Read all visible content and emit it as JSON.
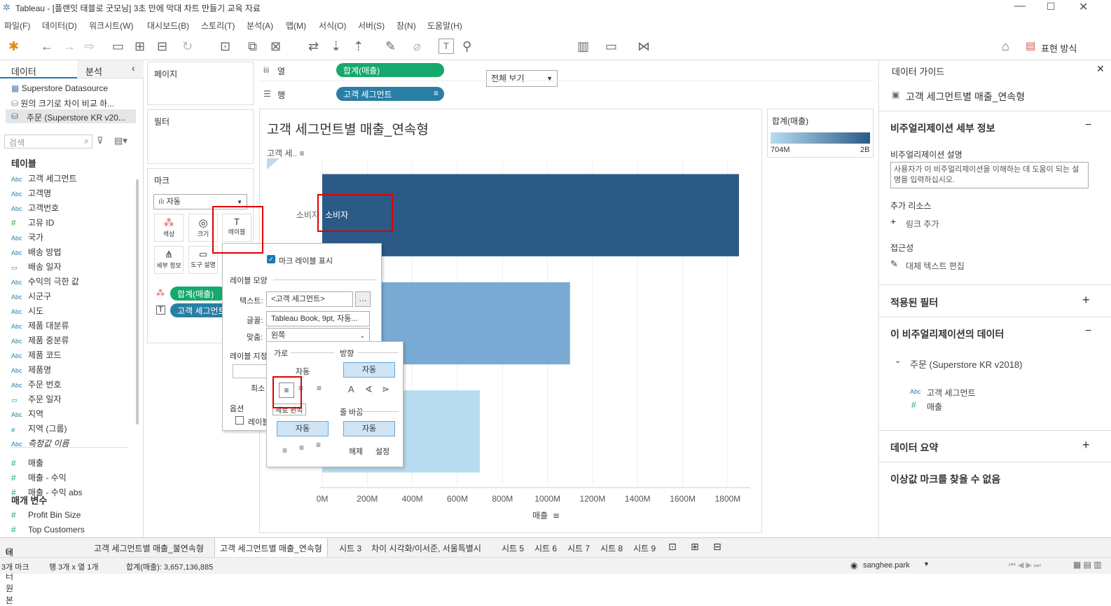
{
  "window": {
    "title": "Tableau - [플랜잇 태블로 굿모닝] 3초 만에 막대 차트 만들기 교육 자료"
  },
  "menu": [
    "파일(F)",
    "데이터(D)",
    "워크시트(W)",
    "대시보드(B)",
    "스토리(T)",
    "분석(A)",
    "맵(M)",
    "서식(O)",
    "서버(S)",
    "창(N)",
    "도움말(H)"
  ],
  "toolbar": {
    "view_select": "전체 보기",
    "show_me": "표현 방식"
  },
  "left": {
    "tab_data": "데이터",
    "tab_analysis": "분석",
    "sources": [
      "Superstore Datasource",
      "원의 크기로 차이 비교 하...",
      "주문 (Superstore KR v20..."
    ],
    "search_placeholder": "검색",
    "tables_header": "테이블",
    "fields": [
      {
        "t": "Abc",
        "n": "고객 세그먼트"
      },
      {
        "t": "Abc",
        "n": "고객명"
      },
      {
        "t": "Abc",
        "n": "고객번호"
      },
      {
        "t": "#",
        "n": "고유 ID"
      },
      {
        "t": "Abc",
        "n": "국가"
      },
      {
        "t": "Abc",
        "n": "배송 방법"
      },
      {
        "t": "date",
        "n": "배송 일자"
      },
      {
        "t": "Abc",
        "n": "수익의 극한 값"
      },
      {
        "t": "Abc",
        "n": "시군구"
      },
      {
        "t": "Abc",
        "n": "시도"
      },
      {
        "t": "Abc",
        "n": "제품 대분류"
      },
      {
        "t": "Abc",
        "n": "제품 중분류"
      },
      {
        "t": "Abc",
        "n": "제품 코드"
      },
      {
        "t": "Abc",
        "n": "제품명"
      },
      {
        "t": "Abc",
        "n": "주문 번호"
      },
      {
        "t": "date",
        "n": "주문 일자"
      },
      {
        "t": "Abc",
        "n": "지역"
      },
      {
        "t": "clip",
        "n": "지역 (그룹)"
      },
      {
        "t": "Abc",
        "n": "측정값 이름"
      },
      {
        "t": "#",
        "n": "매출"
      },
      {
        "t": "#",
        "n": "매출 - 수익"
      },
      {
        "t": "#",
        "n": "매출 - 수익 abs"
      }
    ],
    "params_header": "매개 변수",
    "params": [
      "Profit Bin Size",
      "Top Customers"
    ]
  },
  "shelves": {
    "pages": "페이지",
    "filters": "필터",
    "marks": "마크",
    "marks_type": "자동",
    "btn_color": "색상",
    "btn_size": "크기",
    "btn_label": "레이블",
    "btn_detail": "세부 정보",
    "btn_tooltip": "도구 설명",
    "mark_pill1": "합계(매출)",
    "mark_pill2": "고객 세그먼트",
    "cols_label": "열",
    "rows_label": "행",
    "cols_pill": "합계(매출)",
    "rows_pill": "고객 세그먼트"
  },
  "chart_data": {
    "type": "bar",
    "title": "고객 세그먼트별 매출_연속형",
    "categories": [
      "소비자",
      "",
      ""
    ],
    "values": [
      1850,
      1100,
      700
    ],
    "xlabel": "매출",
    "ylabel": "고객 세..",
    "xticks": [
      "0M",
      "200M",
      "400M",
      "600M",
      "800M",
      "1000M",
      "1200M",
      "1400M",
      "1600M",
      "1800M"
    ],
    "xlim": [
      0,
      1900
    ],
    "colors": [
      "#2b5a87",
      "#79aad3",
      "#b8dcef"
    ],
    "legend": {
      "title": "합계(매출)",
      "min": "704M",
      "max": "2B"
    }
  },
  "label_popup": {
    "show_labels": "마크 레이블 표시",
    "appearance": "레이블 모양",
    "text_label": "텍스트:",
    "text_value": "<고객 세그먼트>",
    "font_label": "글꼴:",
    "font_value": "Tableau Book, 9pt, 자동...",
    "align_label": "맞춤:",
    "align_value": "왼쪽",
    "marks_to_label": "레이블 지정",
    "min_label": "최소",
    "options": "옵션",
    "label_cb": "레이블"
  },
  "align_popup": {
    "horizontal": "가로",
    "direction": "방향",
    "auto1": "자동",
    "auto2": "자동",
    "vertical": "세로",
    "wrap": "줄 바꿈",
    "auto3": "자동",
    "auto4": "자동",
    "wrap_off": "해제",
    "wrap_on": "설정",
    "tooltip": "왼쪽"
  },
  "guide": {
    "title": "데이터 가이드",
    "sheet": "고객 세그먼트별 매출_연속형",
    "viz_details": "비주얼리제이션 세부 정보",
    "viz_desc_label": "비주얼리제이션 설명",
    "viz_desc_placeholder": "사용자가 이 비주얼리제이션을 이해하는 데 도움이 되는 설명을 입력하십시오.",
    "more_resources": "추가 리소스",
    "add_link": "링크 추가",
    "accessibility": "접근성",
    "alt_text": "대체 텍스트 편집",
    "applied_filters": "적용된 필터",
    "viz_data": "이 비주얼리제이션의 데이터",
    "ds_name": "주문 (Superstore KR v2018)",
    "ds_field1": "고객 세그먼트",
    "ds_field2": "매출",
    "data_summary": "데이터 요약",
    "outliers": "이상값 마크를 찾을 수 없음"
  },
  "tabs": [
    "데이터 원본",
    "고객 세그먼트별 매출_불연속형",
    "고객 세그먼트별 매출_연속형",
    "시트 3",
    "차이 시각화/이서준, 서울특별시",
    "시트 5",
    "시트 6",
    "시트 7",
    "시트 8",
    "시트 9"
  ],
  "status": {
    "marks": "3개 마크",
    "rc": "행 3개 x 열 1개",
    "sum": "합계(매출): 3,657,136,885",
    "user": "sanghee.park"
  }
}
